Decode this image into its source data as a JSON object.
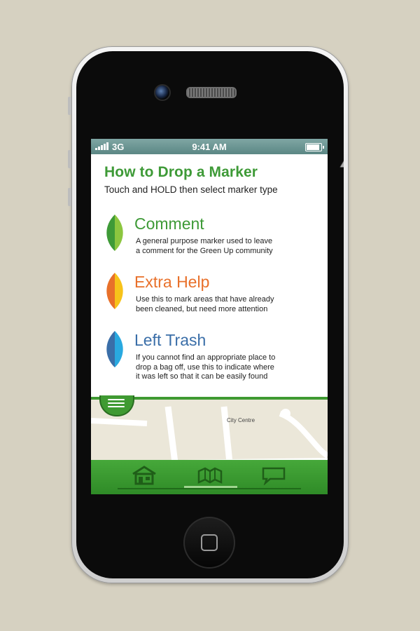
{
  "status_bar": {
    "carrier": "3G",
    "time": "9:41 AM",
    "battery_level": 0.9
  },
  "help": {
    "title": "How to Drop a Marker",
    "subtitle": "Touch and HOLD then select marker type"
  },
  "markers": [
    {
      "title": "Comment",
      "description_lines": [
        "A general purpose marker used to leave",
        "a comment for the Green Up community"
      ],
      "color": "#3e9a37",
      "leaf_colors": [
        "#3e9a37",
        "#8cc63f"
      ]
    },
    {
      "title": "Extra Help",
      "description_lines": [
        "Use this to mark areas that have already",
        "been cleaned, but need more attention"
      ],
      "color": "#e8702a",
      "leaf_colors": [
        "#e8702a",
        "#f7c31a"
      ]
    },
    {
      "title": "Left Trash",
      "description_lines": [
        "If you cannot find an appropriate place to",
        "drop a bag off, use this to indicate where",
        "it was left so that it can be easily found"
      ],
      "color": "#3a6ea8",
      "leaf_colors": [
        "#3a6ea8",
        "#29a9e0"
      ]
    }
  ],
  "map": {
    "label": "City Centre"
  },
  "tabs": [
    {
      "icon": "home-icon",
      "active": false
    },
    {
      "icon": "map-icon",
      "active": true
    },
    {
      "icon": "chat-icon",
      "active": false
    }
  ]
}
